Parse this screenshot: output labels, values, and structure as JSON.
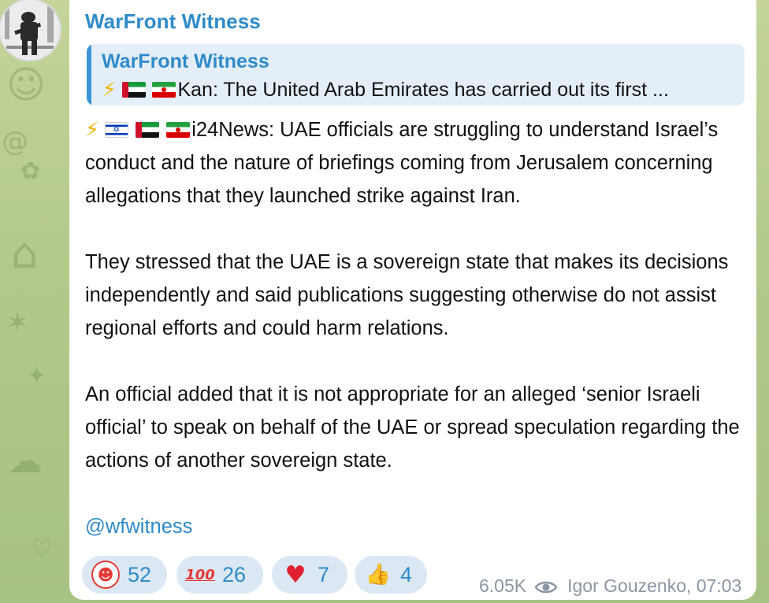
{
  "channel": {
    "name": "WarFront Witness"
  },
  "reply": {
    "title": "WarFront Witness",
    "text": "Kan: The United Arab Emirates has carried out its first ..."
  },
  "message": {
    "headline": "i24News: UAE officials are struggling to understand Israel’s conduct and the nature of briefings coming from Jerusalem concerning allegations that they launched strike against Iran.",
    "paragraph2": "They stressed that the UAE is a sovereign state that makes its decisions independently and said publications suggesting otherwise do not assist regional efforts and could harm relations.",
    "paragraph3": "An official added that it is not appropriate for an alleged ‘senior Israeli official’ to speak on behalf of the UAE or spread speculation regarding the actions of another sovereign state.",
    "link": "@wfwitness"
  },
  "reactions": [
    {
      "icon": "clown-face-icon",
      "count": "52"
    },
    {
      "icon": "hundred-points-icon",
      "count": "26"
    },
    {
      "icon": "red-heart-icon",
      "count": "7"
    },
    {
      "icon": "thumbs-up-icon",
      "count": "4"
    }
  ],
  "meta": {
    "views": "6.05K",
    "author_time": "Igor Gouzenko, 07:03"
  },
  "colors": {
    "accent": "#2f8bc9",
    "reply_bg": "#e3eef8",
    "reaction_bg": "#dbe8f4",
    "wallpaper": "#b2c98a"
  }
}
